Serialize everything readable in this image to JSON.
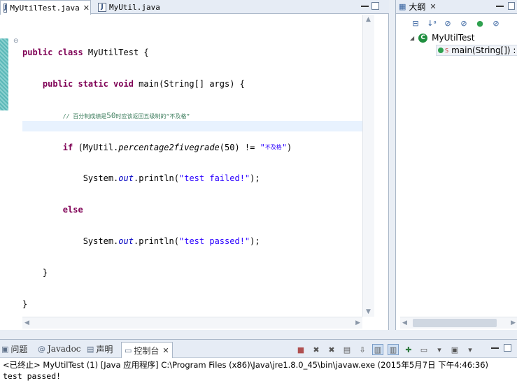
{
  "editor": {
    "tabs": [
      {
        "label": "MyUtilTest.java",
        "active": true
      },
      {
        "label": "MyUtil.java",
        "active": false
      }
    ],
    "tab_close_glyph": "✕",
    "code": {
      "l1_kw": "public class",
      "l1_rest": " MyUtilTest {",
      "l2_kw": "public static void",
      "l2_rest": " main(String[] args) {",
      "l3_comment_a": "// 百分制成绩是",
      "l3_comment_b": "50",
      "l3_comment_c": "时应该返回五级制的“不及格”",
      "l4_kw": "if",
      "l4_pre": " (MyUtil.",
      "l4_method": "percentage2fivegrade",
      "l4_post": "(50) != ",
      "l4_str_q1": "\"",
      "l4_str": "不及格",
      "l4_str_q2": "\"",
      "l4_end": ")",
      "l5_pre": "System.",
      "l5_field": "out",
      "l5_mid": ".println(",
      "l5_str": "\"test failed!\"",
      "l5_end": ");",
      "l6_kw": "else",
      "l7_pre": "System.",
      "l7_field": "out",
      "l7_mid": ".println(",
      "l7_str": "\"test passed!\"",
      "l7_end": ");",
      "l8": "}",
      "l9": "}"
    }
  },
  "outline": {
    "tab_label": "大纲",
    "close_glyph": "✕",
    "toolbar_icons": [
      "collapse-all-icon",
      "sort-icon",
      "hide-fields-icon",
      "hide-static-icon",
      "hide-nonpublic-icon",
      "hide-local-types-icon"
    ],
    "class_name": "MyUtilTest",
    "method_name": "main(String[]) :"
  },
  "bottom": {
    "tabs": [
      {
        "label": "问题",
        "icon": "problems-icon"
      },
      {
        "label": "Javadoc",
        "icon": "javadoc-icon"
      },
      {
        "label": "声明",
        "icon": "declaration-icon"
      },
      {
        "label": "控制台",
        "icon": "console-icon",
        "active": true
      }
    ],
    "close_glyph": "✕",
    "console_header": "<已终止> MyUtilTest (1) [Java 应用程序] C:\\Program Files (x86)\\Java\\jre1.8.0_45\\bin\\javaw.exe (2015年5月7日 下午4:46:36)",
    "console_output": "test passed!"
  },
  "colors": {
    "keyword": "#7f0055",
    "comment": "#3f7f5f",
    "string": "#2a00ff",
    "field": "#0000c0",
    "current_line": "#e8f2fe",
    "tab_bar": "#e6ecf5"
  }
}
